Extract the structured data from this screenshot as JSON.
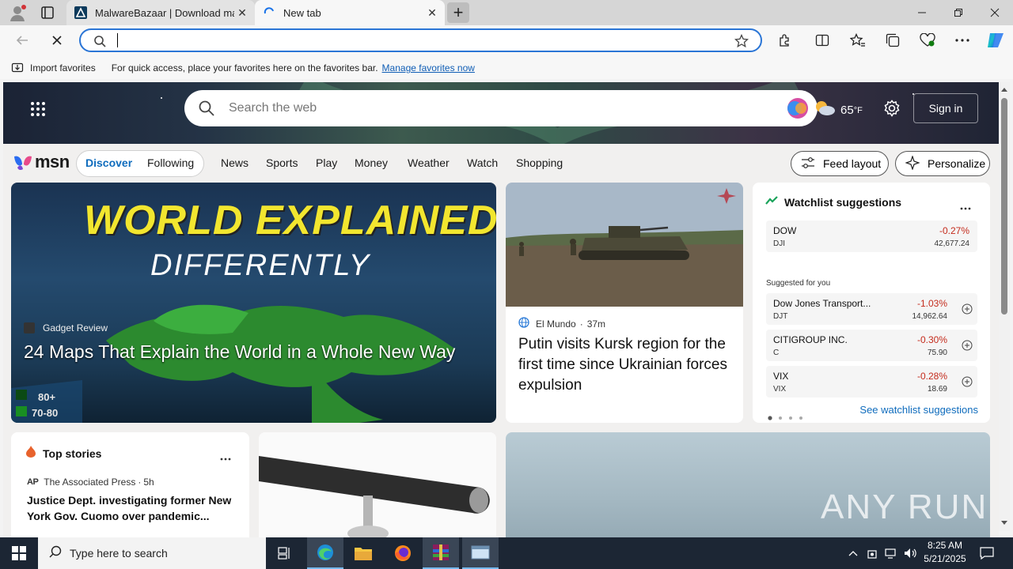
{
  "browser": {
    "tabs": [
      {
        "title": "MalwareBazaar | Download malw",
        "active": false
      },
      {
        "title": "New tab",
        "active": true
      }
    ],
    "new_tab_symbol": "+",
    "address_value": "",
    "favorites_bar": {
      "import_label": "Import favorites",
      "message": "For quick access, place your favorites here on the favorites bar.",
      "manage_link": "Manage favorites now"
    }
  },
  "msn": {
    "search_placeholder": "Search the web",
    "weather_temp": "65",
    "weather_unit": "°F",
    "sign_in": "Sign in",
    "logo_text": "msn",
    "pill_tabs": [
      "Discover",
      "Following"
    ],
    "nav": [
      "News",
      "Sports",
      "Play",
      "Money",
      "Weather",
      "Watch",
      "Shopping"
    ],
    "feed_layout": "Feed layout",
    "personalize": "Personalize",
    "hero_card": {
      "image_title_line1": "WORLD EXPLAINED",
      "image_title_line2": "DIFFERENTLY",
      "source": "Gadget Review",
      "headline": "24 Maps That Explain the World in a Whole New Way",
      "legend": [
        "80+",
        "70-80"
      ]
    },
    "news_card": {
      "source": "El Mundo",
      "age": "37m",
      "headline": "Putin visits Kursk region for the first time since Ukrainian forces expulsion"
    },
    "watchlist": {
      "title": "Watchlist suggestions",
      "main": {
        "name": "DOW",
        "ticker": "DJI",
        "change": "-0.27%",
        "price": "42,677.24"
      },
      "suggested_label": "Suggested for you",
      "items": [
        {
          "name": "Dow Jones Transport...",
          "ticker": "DJT",
          "change": "-1.03%",
          "price": "14,962.64"
        },
        {
          "name": "CITIGROUP INC.",
          "ticker": "C",
          "change": "-0.30%",
          "price": "75.90"
        },
        {
          "name": "VIX",
          "ticker": "VIX",
          "change": "-0.28%",
          "price": "18.69"
        }
      ],
      "see_link": "See watchlist suggestions",
      "negative_color": "#c42b1c"
    },
    "top_stories": {
      "title": "Top stories",
      "source": "The Associated Press",
      "age": "5h",
      "headline": "Justice Dept. investigating former New York Gov. Cuomo over pandemic..."
    },
    "watermark": "ANY RUN"
  },
  "taskbar": {
    "search_placeholder": "Type here to search",
    "time": "8:25 AM",
    "date": "5/21/2025"
  },
  "colors": {
    "accent": "#0f6cbd",
    "edge_address_border": "#2a75d6",
    "taskbar": "#1c2634"
  }
}
